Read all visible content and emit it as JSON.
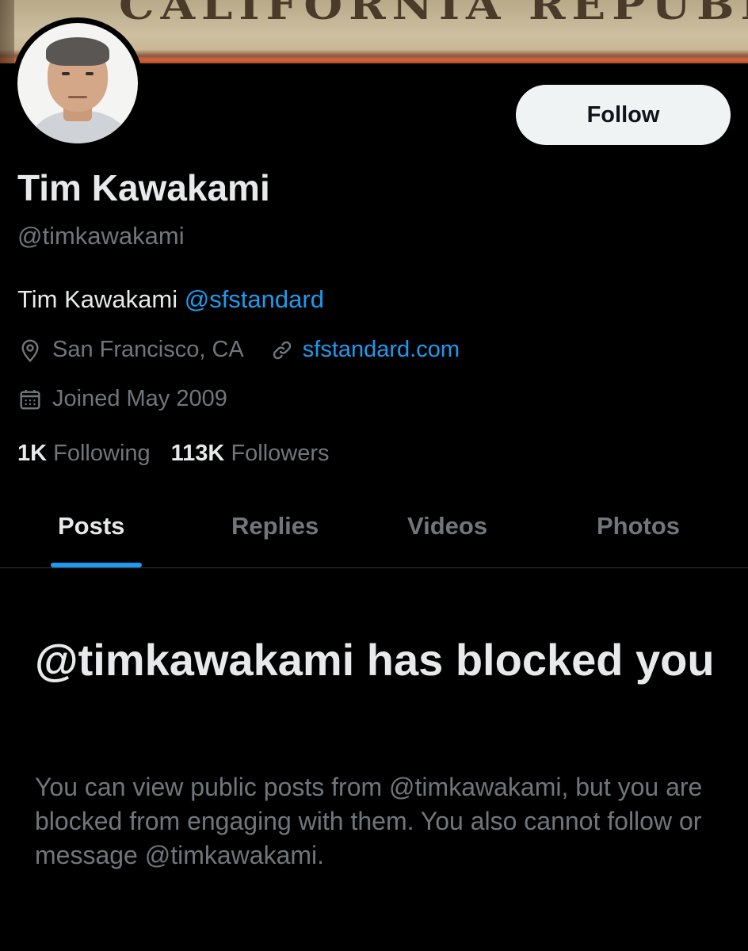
{
  "banner": {
    "text": "CALIFORNIA REPUBLIC"
  },
  "profile": {
    "follow_label": "Follow",
    "name": "Tim Kawakami",
    "handle": "@timkawakami",
    "bio_text": "Tim Kawakami ",
    "bio_mention": "@sfstandard",
    "location": "San Francisco, CA",
    "website": "sfstandard.com",
    "joined": "Joined May 2009",
    "following_count": "1K",
    "following_label": "Following",
    "followers_count": "113K",
    "followers_label": "Followers"
  },
  "tabs": [
    {
      "label": "Posts",
      "active": true
    },
    {
      "label": "Replies",
      "active": false
    },
    {
      "label": "Videos",
      "active": false
    },
    {
      "label": "Photos",
      "active": false
    }
  ],
  "blocked": {
    "title": "@timkawakami has blocked you",
    "body": "You can view public posts from @timkawakami, but you are blocked from engaging with them. You also cannot follow or message @timkawakami."
  },
  "colors": {
    "background": "#000000",
    "text_primary": "#e7e9ea",
    "text_secondary": "#71767b",
    "accent": "#1d9bf0",
    "button_bg": "#eff3f4"
  },
  "icons": {
    "location": "location-pin-icon",
    "website": "link-icon",
    "joined": "calendar-icon"
  }
}
